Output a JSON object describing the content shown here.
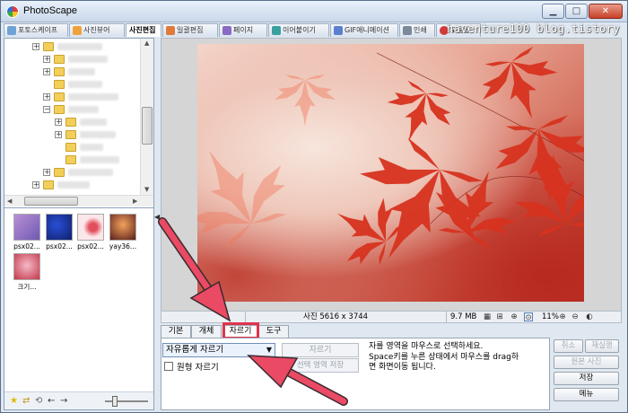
{
  "window": {
    "title": "PhotoScape",
    "min_glyph": "▁",
    "max_glyph": "□",
    "close_glyph": "✕"
  },
  "tabs": [
    {
      "label": "포토스케이프",
      "color": "#6fa3d8"
    },
    {
      "label": "사진뷰어",
      "color": "#f0a23a"
    },
    {
      "label": "사진편집",
      "color": "#4a9a4f"
    },
    {
      "label": "일괄편집",
      "color": "#e07a3a"
    },
    {
      "label": "페이지",
      "color": "#8a6bc4"
    },
    {
      "label": "이어붙이기",
      "color": "#39a0a0"
    },
    {
      "label": "GIF애니메이션",
      "color": "#5a7fd0"
    },
    {
      "label": "인쇄",
      "color": "#7a8a9a"
    },
    {
      "label": "도움말",
      "color": "#d33a3a"
    }
  ],
  "watermark": "haventure100 blog.tistory",
  "thumbnails": [
    {
      "caption": "psx02...",
      "colors": [
        "#b98fd6",
        "#6f5ab2"
      ]
    },
    {
      "caption": "psx02...",
      "colors": [
        "#2a4fd6",
        "#0f1f6a"
      ]
    },
    {
      "caption": "psx02...",
      "colors": [
        "#fbe6ea",
        "#e24d5a"
      ]
    },
    {
      "caption": "yay36...",
      "colors": [
        "#f3a25d",
        "#5a1f1a"
      ]
    },
    {
      "caption": "크기...",
      "colors": [
        "#f5b9c8",
        "#c2384a"
      ]
    }
  ],
  "status": {
    "photo_info": "사진 5616 x 3744",
    "file_size": "9.7 MB",
    "zoom": "11%"
  },
  "edit_tabs": [
    "기본",
    "개체",
    "자르기",
    "도구"
  ],
  "crop": {
    "mode": "자유롭게 자르기",
    "crop_button": "자르기",
    "save_selection_button": "선택 영역 저장",
    "round_crop_label": "원형 자르기",
    "instructions": [
      "자를 영역을 마우스로 선택하세요.",
      "Space키를 누른 상태에서 마우스를 drag하",
      "면 화면이동 됩니다."
    ]
  },
  "actions": {
    "cancel": "취소",
    "redo": "재실행",
    "original": "원본 사진",
    "save": "저장",
    "menu": "메뉴"
  },
  "colors": {
    "annotation": "#e0334b"
  }
}
